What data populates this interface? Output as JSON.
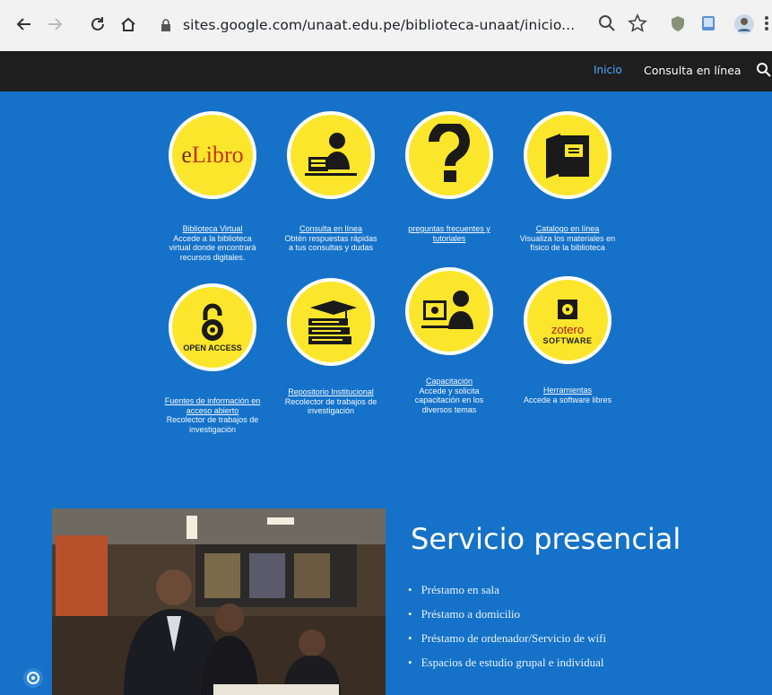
{
  "browser": {
    "url": "sites.google.com/unaat.edu.pe/biblioteca-unaat/inicio..."
  },
  "site_nav": {
    "items": [
      "Inicio",
      "Consulta en línea"
    ]
  },
  "tiles": [
    {
      "icon": "elibro-logo",
      "logo_text_e": "e",
      "logo_text_libro": "Libro",
      "title": "Biblioteca Virtual",
      "desc": "Accede a la biblioteca virtual donde encontrará recursos digitales."
    },
    {
      "icon": "reader-desk-icon",
      "title": "Consulta en línea",
      "desc": "Obtén respuestas rápidas a tus consultas y dudas"
    },
    {
      "icon": "question-mark-icon",
      "title": "preguntas frecuentes y tutoriales",
      "desc": ""
    },
    {
      "icon": "catalog-book-icon",
      "title": "Catalogo en línea",
      "desc": "Visualiza los materiales en físico de la biblioteca"
    },
    {
      "icon": "open-access-icon",
      "logo_text": "OPEN ACCESS",
      "title": "Fuentes de información en acceso abierto",
      "desc": "Recolector de trabajos de investigación"
    },
    {
      "icon": "repository-books-icon",
      "title": "Repositorio Institucional",
      "desc": "Recolector de trabajos de investigación"
    },
    {
      "icon": "training-icon",
      "title": "Capacitación",
      "desc": "Accede y solicita capacitación en los diversos temas"
    },
    {
      "icon": "zotero-software-icon",
      "logo_text_z": "zotero",
      "logo_text_s": "SOFTWARE",
      "title": "Herramientas",
      "desc": "Accede a software libres"
    }
  ],
  "service": {
    "title": "Servicio presencial",
    "items": [
      "Préstamo en sala",
      "Préstamo a domicilio",
      "Préstamo de ordenador/Servicio de wifi",
      "Espacios de estudio grupal e individual"
    ]
  },
  "colors": {
    "content_bg": "#1572c8",
    "header_bg": "#1e1e1e",
    "circle_fill": "#fbe62b",
    "nav_active": "#4fa9ff"
  }
}
